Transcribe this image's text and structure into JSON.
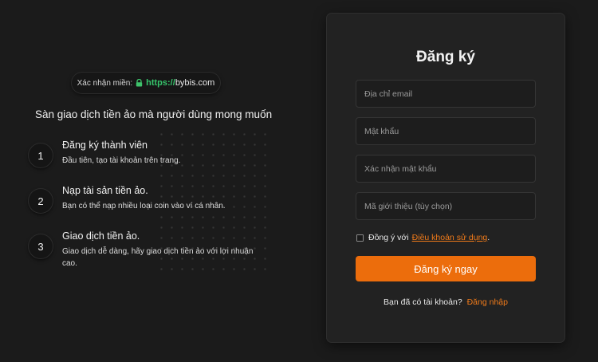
{
  "verify": {
    "label": "Xác nhận miền:",
    "icon": "lock-icon",
    "url_scheme": "https://",
    "url_host": "bybis.com",
    "accent": "#36c46b"
  },
  "tagline": "Sàn giao dịch tiền ảo mà người dùng mong muốn",
  "steps": [
    {
      "num": "1",
      "title": "Đăng ký thành viên",
      "desc": "Đầu tiên, tạo tài khoản trên trang."
    },
    {
      "num": "2",
      "title": "Nạp tài sản tiền ảo.",
      "desc": "Bạn có thể nạp nhiều loại coin vào ví cá nhân."
    },
    {
      "num": "3",
      "title": "Giao dịch tiền ảo.",
      "desc": "Giao dịch dễ dàng, hãy giao dịch tiền ảo với lợi nhuận cao."
    }
  ],
  "form": {
    "title": "Đăng ký",
    "email_placeholder": "Địa chỉ email",
    "password_placeholder": "Mật khẩu",
    "confirm_placeholder": "Xác nhận mật khẩu",
    "referral_placeholder": "Mã giới thiệu (tùy chọn)",
    "agree_prefix": "Đồng ý với",
    "terms_link": "Điều khoản sử dụng",
    "agree_suffix": ".",
    "submit_label": "Đăng ký ngay",
    "have_account": "Bạn đã có tài khoản?",
    "login_link": "Đăng nhập",
    "accent": "#ec6d0c"
  }
}
